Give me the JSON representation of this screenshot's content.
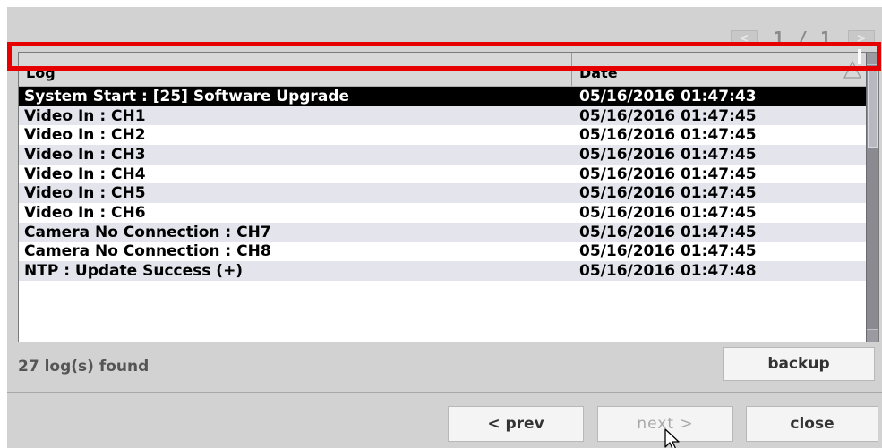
{
  "pager": {
    "prev_label": "<",
    "page_text": "1 / 1",
    "next_label": ">"
  },
  "table": {
    "columns": [
      "Log",
      "Date"
    ],
    "rows": [
      {
        "log": "System Start : [25] Software Upgrade",
        "date": "05/16/2016 01:47:43",
        "selected": true
      },
      {
        "log": "Video In : CH1",
        "date": "05/16/2016 01:47:45"
      },
      {
        "log": "Video In : CH2",
        "date": "05/16/2016 01:47:45"
      },
      {
        "log": "Video In : CH3",
        "date": "05/16/2016 01:47:45"
      },
      {
        "log": "Video In : CH4",
        "date": "05/16/2016 01:47:45"
      },
      {
        "log": "Video In : CH5",
        "date": "05/16/2016 01:47:45"
      },
      {
        "log": "Video In : CH6",
        "date": "05/16/2016 01:47:45"
      },
      {
        "log": "Camera No Connection : CH7",
        "date": "05/16/2016 01:47:45"
      },
      {
        "log": "Camera No Connection : CH8",
        "date": "05/16/2016 01:47:45"
      },
      {
        "log": "NTP : Update Success (+)",
        "date": "05/16/2016 01:47:48"
      }
    ]
  },
  "footer": {
    "found_text": "27 log(s) found",
    "backup_label": "backup",
    "prev_label": "< prev",
    "next_label": "next >",
    "close_label": "close"
  },
  "colors": {
    "highlight": "#e60000",
    "selected_row": "#000000",
    "panel": "#d2d2d2"
  },
  "icons": {
    "sort": "sort-up-triangle-icon",
    "cursor": "mouse-pointer-icon"
  }
}
